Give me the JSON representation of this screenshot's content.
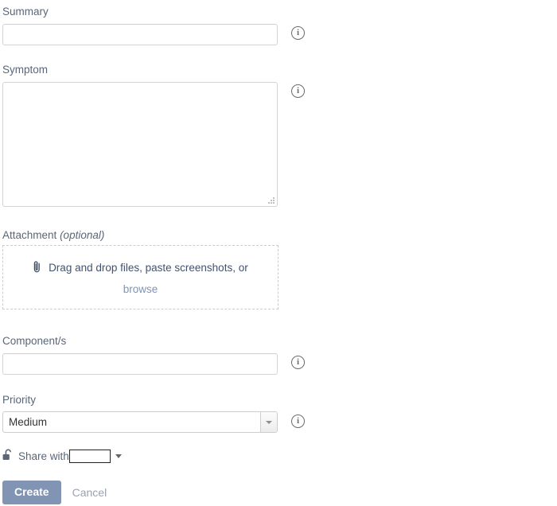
{
  "form": {
    "summary": {
      "label": "Summary",
      "value": "",
      "placeholder": "",
      "info_icon": "info-circle-icon"
    },
    "symptom": {
      "label": "Symptom",
      "value": "",
      "placeholder": "",
      "info_icon": "info-circle-icon"
    },
    "attachment": {
      "label": "Attachment",
      "label_optional": "(optional)",
      "dropzone_text": "Drag and drop files, paste screenshots, or",
      "browse_label": "browse",
      "paperclip_icon": "paperclip-icon"
    },
    "components": {
      "label": "Component/s",
      "value": "",
      "placeholder": "",
      "info_icon": "info-circle-icon"
    },
    "priority": {
      "label": "Priority",
      "selected": "Medium",
      "options": [
        "Medium"
      ],
      "info_icon": "info-circle-icon"
    },
    "share": {
      "lock_icon": "unlocked-padlock-icon",
      "label": "Share with",
      "value": "",
      "placeholder": ""
    },
    "actions": {
      "create_label": "Create",
      "cancel_label": "Cancel"
    }
  },
  "colors": {
    "primary_button": "#8194b4",
    "label_text": "#5a6678",
    "link": "#8194b4",
    "border": "#d4d4d4",
    "dashed_border": "#cccccc"
  }
}
